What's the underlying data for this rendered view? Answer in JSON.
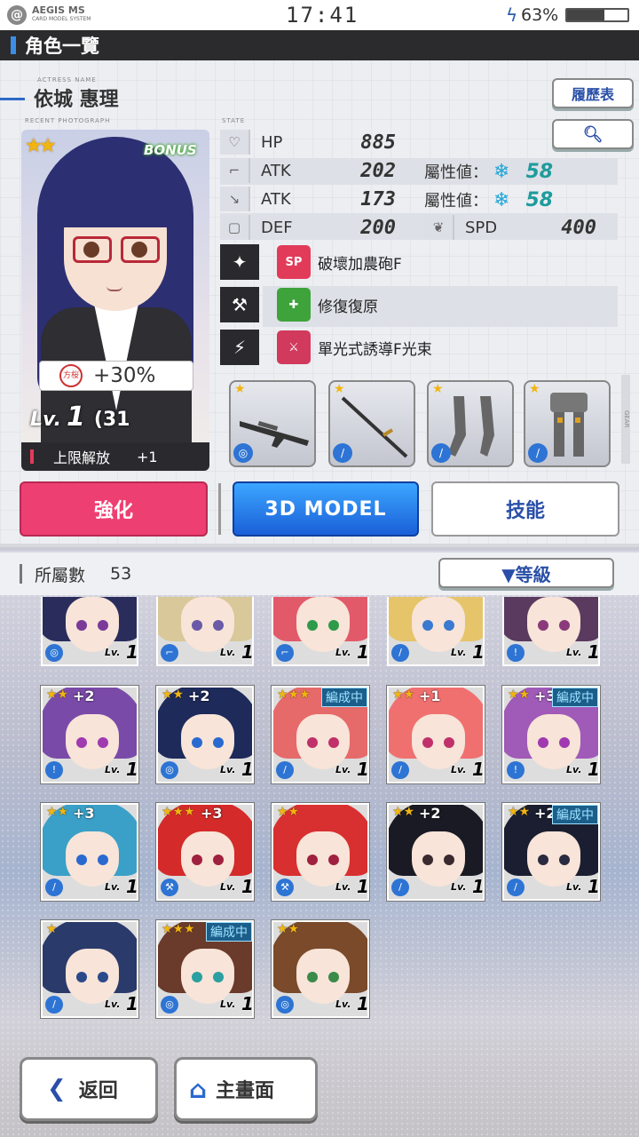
{
  "status_bar": {
    "app_name": "AEGIS MS",
    "app_sub": "CARD MODEL SYSTEM",
    "time": "17:41",
    "battery": "63%",
    "battery_level": 0.63
  },
  "title": "角色一覽",
  "labels": {
    "actress_name": "ACTRESS NAME",
    "recent_photo": "RECENT PHOTOGRAPH",
    "state": "STATE",
    "gear": "GEAR"
  },
  "character": {
    "name": "依城 惠理",
    "rarity_stars": 2,
    "bonus": "BONUS",
    "seal_text": "方桜",
    "bonus_pct": "+30%",
    "lv_prefix": "Lv.",
    "level": "1",
    "level_max": "(31",
    "limit_label": "上限解放",
    "limit_value": "+1"
  },
  "buttons": {
    "history": "履歷表",
    "search_icon": "magnifier",
    "enhance": "強化",
    "model3d": "3D MODEL",
    "skills": "技能",
    "sort": "▼等級",
    "back": "返回",
    "home": "主畫面"
  },
  "stats": [
    {
      "icon": "heart-icon",
      "label": "HP",
      "value": "885"
    },
    {
      "icon": "gun-icon",
      "label": "ATK",
      "value": "202",
      "attr_label": "屬性値：",
      "attr_value": "58"
    },
    {
      "icon": "blade-icon",
      "label": "ATK",
      "value": "173",
      "attr_label": "屬性値：",
      "attr_value": "58"
    },
    {
      "icon": "shield-icon",
      "label": "DEF",
      "value": "200"
    },
    {
      "icon": "wing-icon",
      "label": "SPD",
      "value": "400"
    }
  ],
  "skills": [
    {
      "badge": "SP",
      "badge_color": "#e23b5a",
      "label": "破壞加農砲F"
    },
    {
      "badge": "✚",
      "badge_color": "#3fa33b",
      "label": "修復復原"
    },
    {
      "badge": "⚔",
      "badge_color": "#d13a5d",
      "label": "單光式誘導F光束"
    }
  ],
  "weapons_stars": [
    1,
    1,
    1,
    1
  ],
  "roster_label": "所屬數",
  "roster_count": "53",
  "roster": [
    {
      "stars": "",
      "plus": "",
      "formed": "",
      "hair": "#2a2d5c",
      "eyes": "#7a3a9a",
      "weapon": "◎",
      "lv": "Lv.",
      "n": "1"
    },
    {
      "stars": "",
      "plus": "",
      "formed": "",
      "hair": "#d8c89a",
      "eyes": "#6a5aa8",
      "weapon": "⌐",
      "lv": "Lv.",
      "n": "1"
    },
    {
      "stars": "",
      "plus": "",
      "formed": "",
      "hair": "#e25a6a",
      "eyes": "#2e9a4a",
      "weapon": "⌐",
      "lv": "Lv.",
      "n": "1"
    },
    {
      "stars": "",
      "plus": "",
      "formed": "",
      "hair": "#e6c46a",
      "eyes": "#3a7ad0",
      "weapon": "/",
      "lv": "Lv.",
      "n": "1"
    },
    {
      "stars": "",
      "plus": "",
      "formed": "",
      "hair": "#5a3a5e",
      "eyes": "#8a3a7a",
      "weapon": "!",
      "lv": "Lv.",
      "n": "1"
    },
    {
      "stars": "★★",
      "plus": "+2",
      "formed": "",
      "hair": "#7a4aa8",
      "eyes": "#a03ab0",
      "weapon": "!",
      "lv": "Lv.",
      "n": "1"
    },
    {
      "stars": "★★",
      "plus": "+2",
      "formed": "",
      "hair": "#1e2a5a",
      "eyes": "#2a6ad0",
      "weapon": "◎",
      "lv": "Lv.",
      "n": "1"
    },
    {
      "stars": "★★★",
      "plus": "",
      "formed": "編成中",
      "hair": "#e66a6a",
      "eyes": "#c0306a",
      "weapon": "/",
      "lv": "Lv.",
      "n": "1"
    },
    {
      "stars": "★★",
      "plus": "+1",
      "formed": "",
      "hair": "#f07070",
      "eyes": "#c0306a",
      "weapon": "/",
      "lv": "Lv.",
      "n": "1"
    },
    {
      "stars": "★★",
      "plus": "+3",
      "formed": "編成中",
      "hair": "#a05ab8",
      "eyes": "#a03ab0",
      "weapon": "!",
      "lv": "Lv.",
      "n": "1"
    },
    {
      "stars": "★★",
      "plus": "+3",
      "formed": "",
      "hair": "#3aa0c8",
      "eyes": "#2a6ad0",
      "weapon": "/",
      "lv": "Lv.",
      "n": "1"
    },
    {
      "stars": "★★★",
      "plus": "+3",
      "formed": "",
      "hair": "#d42a2a",
      "eyes": "#a02040",
      "weapon": "⚒",
      "lv": "Lv.",
      "n": "1"
    },
    {
      "stars": "★★",
      "plus": "",
      "formed": "",
      "hair": "#d83030",
      "eyes": "#a02040",
      "weapon": "⚒",
      "lv": "Lv.",
      "n": "1"
    },
    {
      "stars": "★★",
      "plus": "+2",
      "formed": "",
      "hair": "#1a1a24",
      "eyes": "#3a2a30",
      "weapon": "/",
      "lv": "Lv.",
      "n": "1"
    },
    {
      "stars": "★★",
      "plus": "+2",
      "formed": "編成中",
      "hair": "#1a1e30",
      "eyes": "#2a2a40",
      "weapon": "/",
      "lv": "Lv.",
      "n": "1"
    },
    {
      "stars": "★",
      "plus": "",
      "formed": "",
      "hair": "#2a3a6a",
      "eyes": "#2a4a8a",
      "weapon": "/",
      "lv": "Lv.",
      "n": "1"
    },
    {
      "stars": "★★★",
      "plus": "",
      "formed": "編成中",
      "hair": "#6a3a2a",
      "eyes": "#2aa0a0",
      "weapon": "◎",
      "lv": "Lv.",
      "n": "1"
    },
    {
      "stars": "★★",
      "plus": "",
      "formed": "",
      "hair": "#7a4a2a",
      "eyes": "#3a8a4a",
      "weapon": "◎",
      "lv": "Lv.",
      "n": "1"
    }
  ]
}
